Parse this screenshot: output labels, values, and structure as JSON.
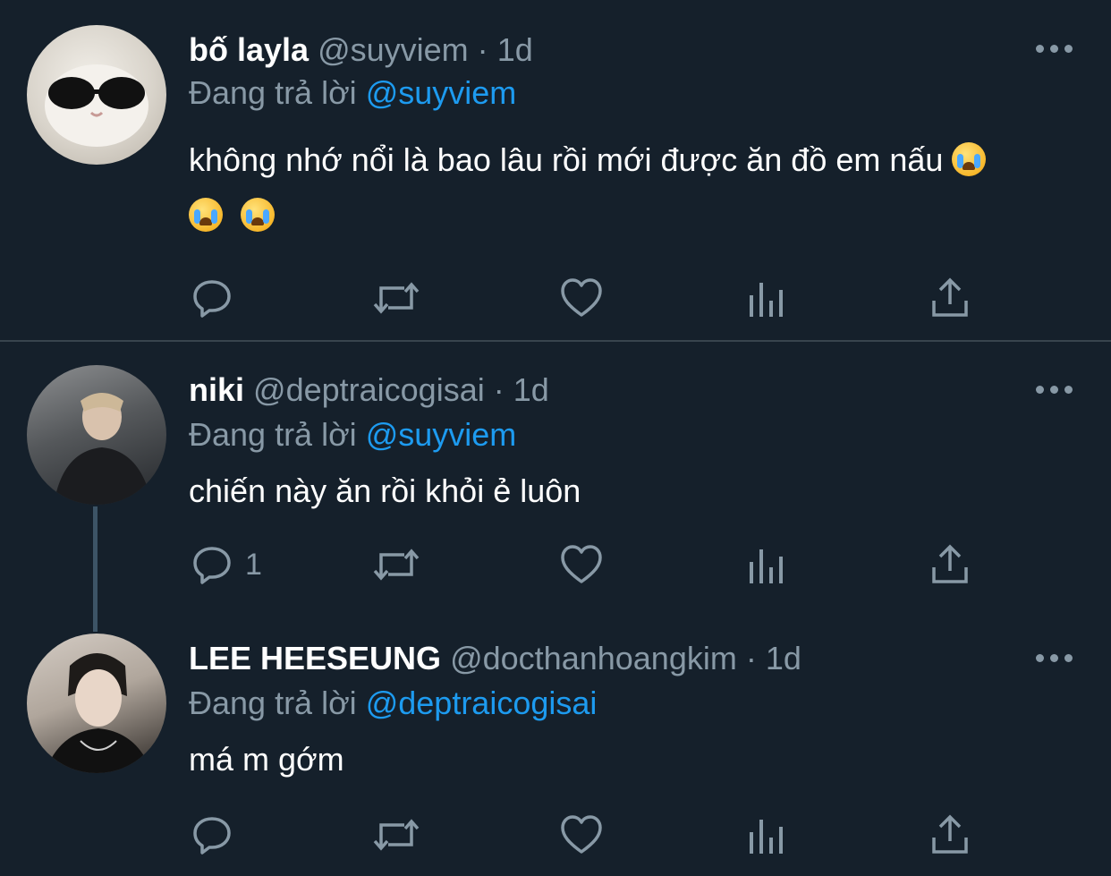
{
  "tweets": [
    {
      "name": "bố layla",
      "handle": "@suyviem",
      "time": "1d",
      "reply_prefix": "Đang trả lời",
      "reply_to": "@suyviem",
      "text": "không nhớ nổi là bao lâu rồi mới được ăn đồ em nấu",
      "emoji": "loudly-crying-face",
      "reply_count": ""
    },
    {
      "name": "niki",
      "handle": "@deptraicogisai",
      "time": "1d",
      "reply_prefix": "Đang trả lời",
      "reply_to": "@suyviem",
      "text": "chiến này ăn rồi khỏi ẻ luôn",
      "reply_count": "1"
    },
    {
      "name": "LEE HEESEUNG",
      "handle": "@docthanhoangkim",
      "time": "1d",
      "reply_prefix": "Đang trả lời",
      "reply_to": "@deptraicogisai",
      "text": "má m gớm",
      "reply_count": ""
    }
  ],
  "separator": "·",
  "icons": [
    "reply-icon",
    "retweet-icon",
    "like-icon",
    "analytics-icon",
    "share-icon",
    "more-icon"
  ],
  "colors": {
    "background": "#15202b",
    "muted": "#8899a6",
    "mention": "#1d9bf0",
    "divider": "#38444d"
  }
}
